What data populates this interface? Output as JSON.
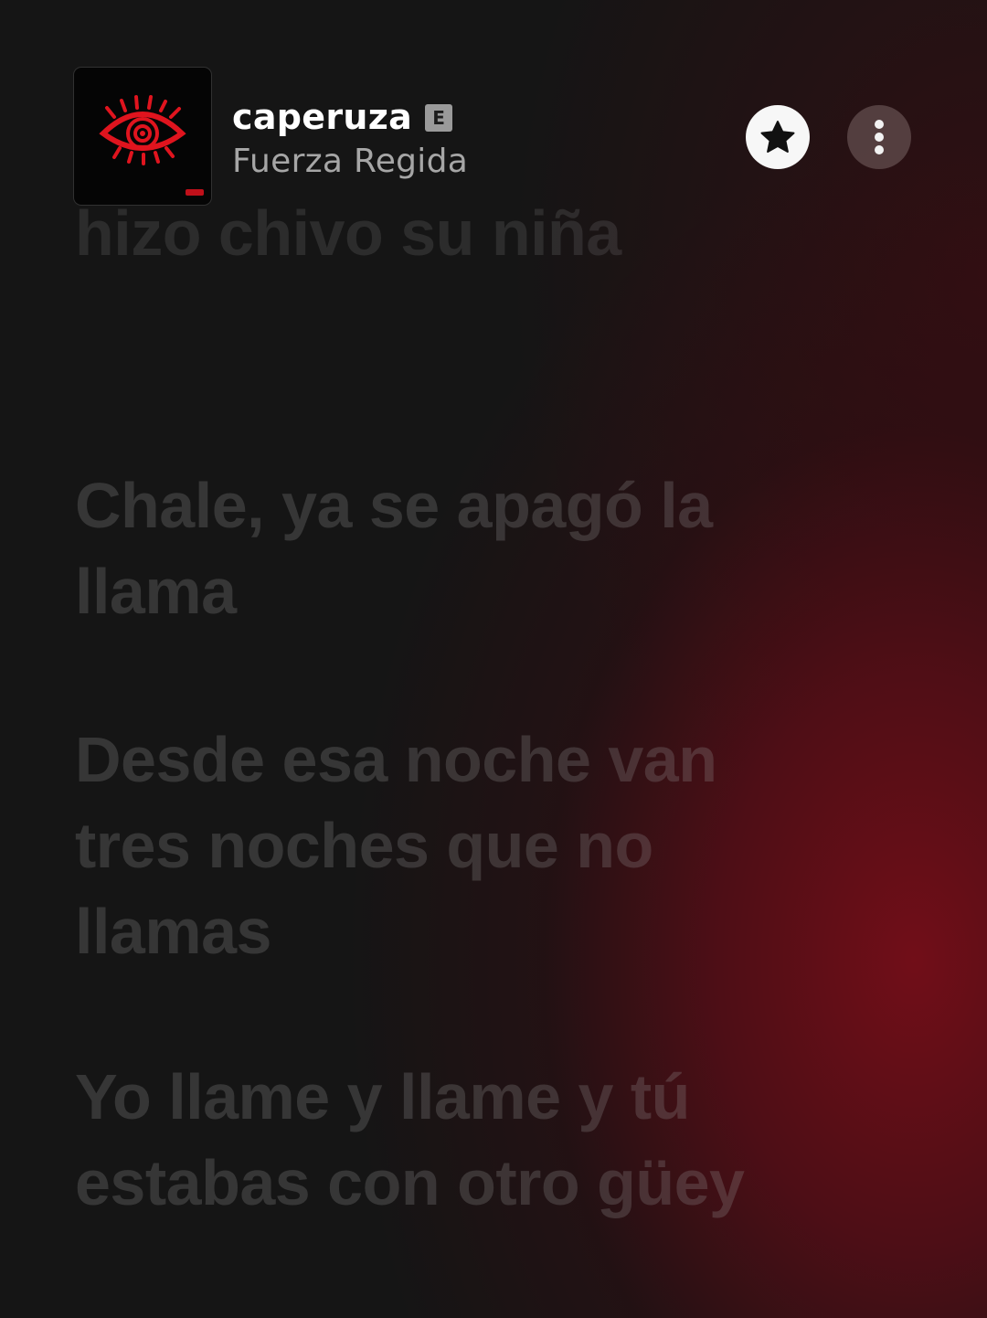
{
  "now_playing": {
    "title": "caperuza",
    "explicit_badge": "E",
    "artist": "Fuerza Regida",
    "artwork_icon": "red-eye-icon",
    "colors": {
      "accent": "#8a0f1c",
      "background": "#151515",
      "artwork_red": "#e0141e"
    }
  },
  "actions": {
    "favorite_icon": "star-icon",
    "more_icon": "more-vertical-icon"
  },
  "lyrics": {
    "lines": [
      "hizo chivo su niña",
      "Chale, ya se apagó la",
      "llama",
      "Desde esa noche van",
      "tres noches que no",
      "llamas",
      "Yo llame y llame y tú",
      "estabas con otro güey"
    ]
  }
}
